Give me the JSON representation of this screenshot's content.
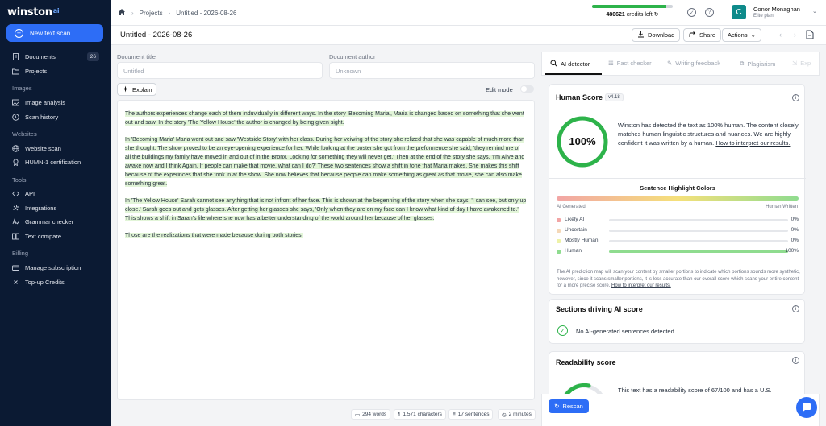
{
  "app": {
    "logo_text": "winston",
    "logo_suffix": "ai",
    "new_scan_label": "New text scan",
    "accent": "#2d6df6"
  },
  "sidebar": {
    "documents_label": "Documents",
    "documents_count": "26",
    "projects_label": "Projects",
    "sections": {
      "images": "Images",
      "websites": "Websites",
      "tools": "Tools",
      "billing": "Billing"
    },
    "images_items": [
      {
        "label": "Image analysis",
        "icon": "image-icon"
      },
      {
        "label": "Scan history",
        "icon": "history-icon"
      }
    ],
    "websites_items": [
      {
        "label": "Website scan",
        "icon": "globe-icon"
      },
      {
        "label": "HUMN-1 certification",
        "icon": "certificate-icon"
      }
    ],
    "tools_items": [
      {
        "label": "API",
        "icon": "code-icon"
      },
      {
        "label": "Integrations",
        "icon": "integrations-icon"
      },
      {
        "label": "Grammar checker",
        "icon": "grammar-icon"
      },
      {
        "label": "Text compare",
        "icon": "compare-icon"
      }
    ],
    "billing_items": [
      {
        "label": "Manage subscription",
        "icon": "subscription-icon"
      },
      {
        "label": "Top-up Credits",
        "icon": "credits-icon"
      }
    ]
  },
  "topbar": {
    "breadcrumb": [
      "Projects",
      "Untitled - 2026-08-26"
    ],
    "credits_value": "480621",
    "credits_suffix": "credits left",
    "credits_fraction": 0.92,
    "user_initial": "C",
    "user_name": "Conor Monaghan",
    "user_plan": "Elite plan"
  },
  "titlebar": {
    "title": "Untitled - 2026-08-26",
    "download_label": "Download",
    "share_label": "Share",
    "actions_label": "Actions"
  },
  "editor": {
    "doc_title_label": "Document title",
    "doc_title_placeholder": "Untitled",
    "doc_author_label": "Document author",
    "doc_author_placeholder": "Unknown",
    "explain_label": "Explain",
    "edit_mode_label": "Edit mode",
    "paragraphs": [
      "The authors experiences change each of them induvidually in different ways. In the story 'Becoming Maria', Maria is changed based on something that she went out and saw. In the story 'The Yellow House' the author is changed by being given sight.",
      "In 'Becoming Maria' Maria went out and saw 'Westside Story' with her class. During her veiwing of the story she relized that she was capable of much more than she thought. The show proved to be an eye-opening experience for her. While looking at the poster she got from the preformence she said, 'they remind me of all the buildings my family have moved in and out of in the Bronx, Looking for something they will never get.' Then at the end of the story she says, 'I'm Alive and awake now and I think Again, If people can make that movie, what can I do?' These two sentences show a shift in tone that Maria makes. She makes this shift because of the experinces that she took in at the show. She now believes that because people can make something as great as that movie, she can also make something great.",
      "In 'The Yellow House' Sarah cannot see anything that is not infront of her face. This is shown at the begenning of the story when she says, 'I can see, but only up close.' Sarah goes out and gets glasses. After getting her glasses she says, 'Only when they are on my face can I know what kind of day I have awakened to.' This shows a shift in Sarah's life where she now has a better understanding of the world around her because of her glasses.",
      "Those are the realizations that were made because during both stories."
    ],
    "stats": {
      "words": "294 words",
      "characters": "1,571 characters",
      "sentences": "17 sentences",
      "read_time": "2 minutes"
    }
  },
  "panel": {
    "tabs": [
      "AI detector",
      "Fact checker",
      "Writing feedback",
      "Plagiarism",
      "Exp"
    ],
    "human_score_title": "Human Score",
    "version": "v4.18",
    "score_text": "100%",
    "score_fraction": 1.0,
    "score_color": "#2db34a",
    "score_desc": "Winston has detected the text as 100% human. The content closely matches human linguistic structures and nuances. We are highly confident it was written by a human.",
    "score_link": "How to interpret our results.",
    "highlight_title": "Sentence Highlight Colors",
    "grad_left": "AI Generated",
    "grad_right": "Human Written",
    "legend": [
      {
        "label": "Likely AI",
        "pct": "0%",
        "value": 0,
        "color": "#f2a5a5"
      },
      {
        "label": "Uncertain",
        "pct": "0%",
        "value": 0,
        "color": "#f5d8b8"
      },
      {
        "label": "Mostly Human",
        "pct": "0%",
        "value": 0,
        "color": "#eef2a8"
      },
      {
        "label": "Human",
        "pct": "100%",
        "value": 100,
        "color": "#8fdc8f"
      }
    ],
    "prediction_text": "The AI prediction map will scan your content by smaller portions to indicate which portions sounds more synthetic, however, since it scans smaller portions, it is less accurate than our overall score which scans your entire content for a more precise score.",
    "prediction_link": "How to interpret our results.",
    "sections_title": "Sections driving AI score",
    "no_ai_text": "No AI-generated sentences detected",
    "readability_title": "Readability score",
    "readability_text": "This text has a readability score of 67/100 and has a U.S.",
    "rescan_label": "Rescan"
  }
}
